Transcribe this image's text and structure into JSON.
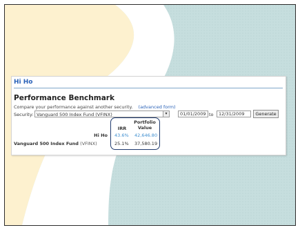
{
  "app_title": "Hi Ho",
  "section": {
    "title": "Performance Benchmark",
    "subtitle": "Compare your performance against another security.",
    "advanced_link": "(advanced form)"
  },
  "form": {
    "security_label": "Security:",
    "security_value": "Vanguard 500 Index Fund (VFINX)",
    "start_date": "01/01/2009",
    "to_label": "to",
    "end_date": "12/31/2009",
    "generate_label": "Generate"
  },
  "results": {
    "headers": {
      "irr": "IRR",
      "portfolio_line1": "Portfolio",
      "portfolio_line2": "Value"
    },
    "rows": [
      {
        "label": "Hi Ho",
        "ticker": "",
        "irr": "43.6%",
        "value": "42,646.80"
      },
      {
        "label": "Vanguard 500 Index Fund",
        "ticker": "(VFINX)",
        "irr": "25.1%",
        "value": "37,580.19"
      }
    ]
  },
  "colors": {
    "accent_blue": "#2a62b8",
    "value_blue": "#3f8fd0",
    "background_teal": "#c6dede",
    "background_cream": "#fdf1cf"
  }
}
